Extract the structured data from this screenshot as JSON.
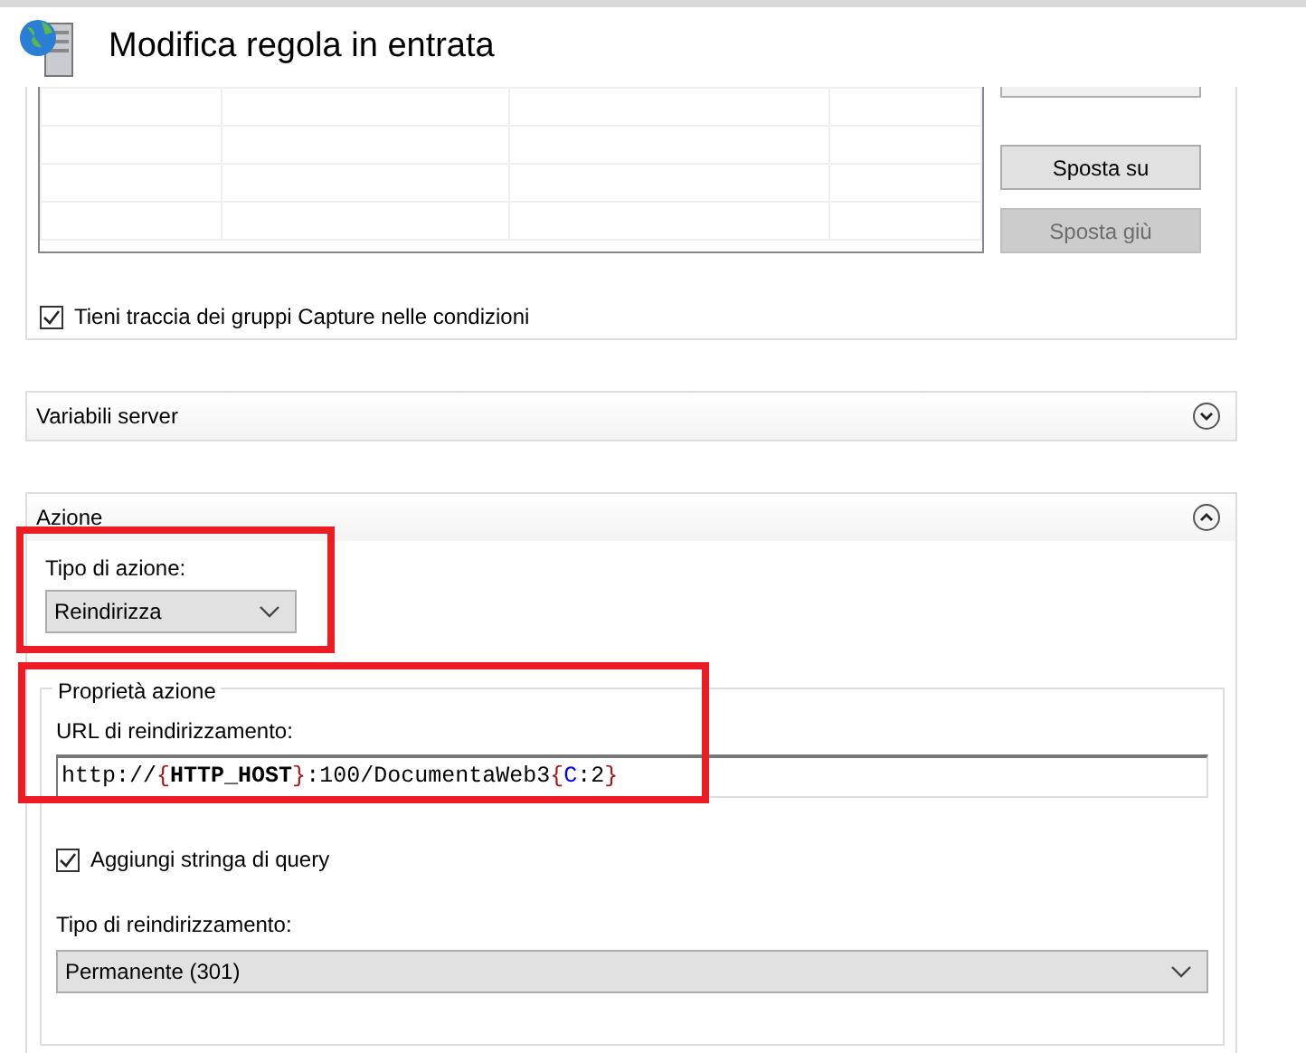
{
  "window": {
    "title": "Modifica regola in entrata"
  },
  "conditions": {
    "buttons": [
      {
        "label": "Sposta su",
        "disabled": false
      },
      {
        "label": "Sposta giù",
        "disabled": true
      }
    ],
    "track_capture": {
      "label": "Tieni traccia dei gruppi Capture nelle condizioni",
      "checked": true
    }
  },
  "server_variables": {
    "title": "Variabili server",
    "expanded": false
  },
  "action": {
    "title": "Azione",
    "expanded": true,
    "action_type": {
      "label": "Tipo di azione:",
      "value": "Reindirizza",
      "highlighted": true
    },
    "properties": {
      "legend": "Proprietà azione",
      "highlighted": true,
      "redirect_url": {
        "label": "URL di reindirizzamento:",
        "segments": [
          {
            "text": "http://",
            "kind": "plain"
          },
          {
            "text": "{",
            "kind": "brace"
          },
          {
            "text": "HTTP_HOST",
            "kind": "variable"
          },
          {
            "text": "}",
            "kind": "brace"
          },
          {
            "text": ":100/DocumentaWeb3",
            "kind": "plain"
          },
          {
            "text": "{",
            "kind": "brace"
          },
          {
            "text": "C",
            "kind": "backref"
          },
          {
            "text": ":2",
            "kind": "plain"
          },
          {
            "text": "}",
            "kind": "brace"
          }
        ]
      },
      "append_query": {
        "label": "Aggiungi stringa di query",
        "checked": true
      },
      "redirect_type": {
        "label": "Tipo di reindirizzamento:",
        "value": "Permanente (301)"
      }
    }
  }
}
